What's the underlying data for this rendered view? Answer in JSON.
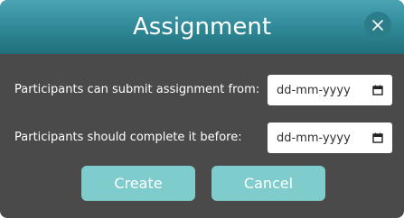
{
  "dialog": {
    "title": "Assignment",
    "close_icon": "close-icon"
  },
  "form": {
    "fields": [
      {
        "label": "Participants can submit assignment from:",
        "placeholder": "dd-mm-yyyy",
        "icon": "calendar-icon"
      },
      {
        "label": "Participants should complete it before:",
        "placeholder": "dd-mm-yyyy",
        "icon": "calendar-icon"
      }
    ]
  },
  "buttons": {
    "create_label": "Create",
    "cancel_label": "Cancel"
  },
  "colors": {
    "header": "#2f8795",
    "body": "#4a4a4a",
    "button": "#7fcccc",
    "text": "#ffffff"
  }
}
